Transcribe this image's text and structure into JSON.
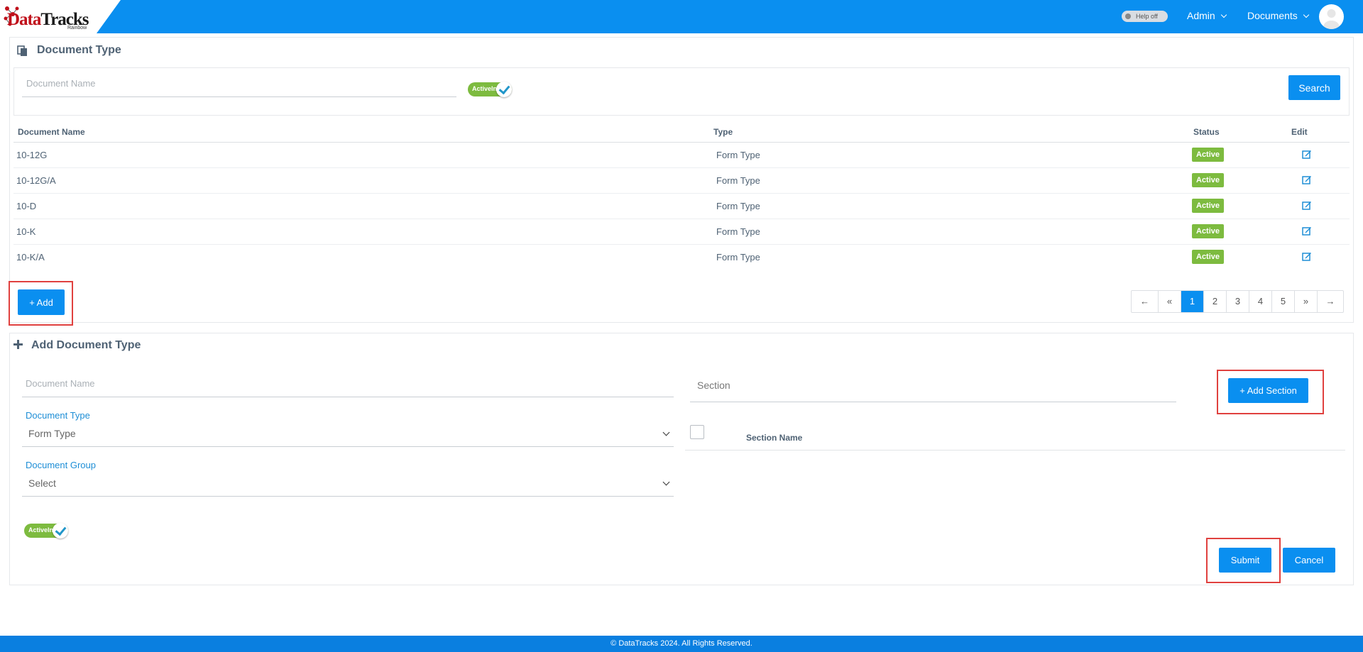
{
  "header": {
    "logo_text_red": "Data",
    "logo_text_dark": "Tracks",
    "logo_subtitle": "Rainbow",
    "help_toggle": "Help off",
    "nav": [
      "Admin",
      "Documents"
    ]
  },
  "search_panel": {
    "title": "Document Type",
    "name_placeholder": "Document Name",
    "active_toggle_label": "ActiveIn",
    "search_button": "Search"
  },
  "table": {
    "columns": [
      "Document Name",
      "Type",
      "Status",
      "Edit"
    ],
    "rows": [
      {
        "name": "10-12G",
        "type": "Form Type",
        "status": "Active"
      },
      {
        "name": "10-12G/A",
        "type": "Form Type",
        "status": "Active"
      },
      {
        "name": "10-D",
        "type": "Form Type",
        "status": "Active"
      },
      {
        "name": "10-K",
        "type": "Form Type",
        "status": "Active"
      },
      {
        "name": "10-K/A",
        "type": "Form Type",
        "status": "Active"
      }
    ]
  },
  "add_button": "+ Add",
  "pagination": {
    "prev_arrow": "←",
    "first": "«",
    "pages": [
      "1",
      "2",
      "3",
      "4",
      "5"
    ],
    "current_page": 1,
    "last": "»",
    "next_arrow": "→"
  },
  "add_panel": {
    "title": "Add Document Type",
    "doc_name_placeholder": "Document Name",
    "doc_type_label": "Document Type",
    "doc_type_value": "Form Type",
    "doc_group_label": "Document Group",
    "doc_group_value": "Select",
    "active_toggle_label": "ActiveIn",
    "section_placeholder": "Section",
    "add_section_button": "+ Add Section",
    "section_name_header": "Section Name",
    "submit_button": "Submit",
    "cancel_button": "Cancel"
  },
  "footer": "© DataTracks 2024. All Rights Reserved.",
  "colors": {
    "primary": "#0a8ff0",
    "active_green": "#7dbb3f",
    "highlight_red": "#e0413f",
    "label_blue": "#1e8ed6"
  }
}
